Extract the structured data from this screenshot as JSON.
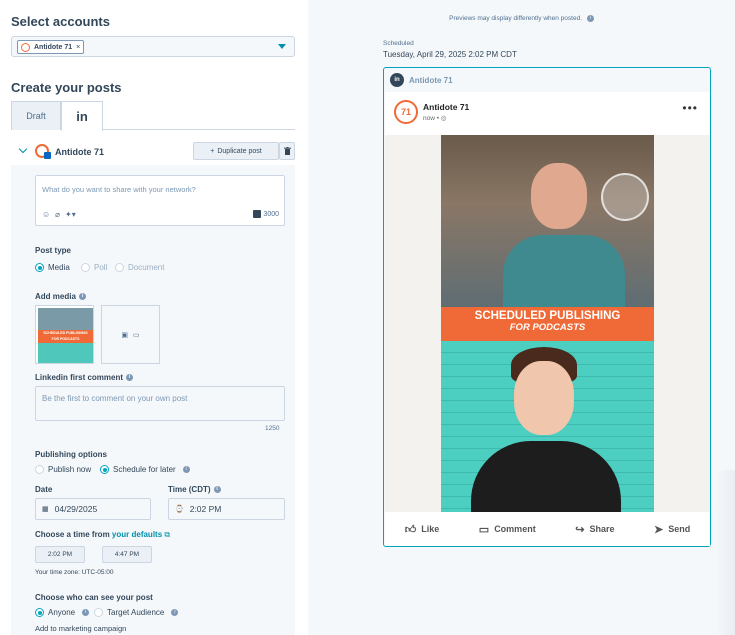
{
  "left": {
    "select_accounts_title": "Select accounts",
    "account_chip": "Antidote 71",
    "create_posts_title": "Create your posts",
    "tabs": [
      {
        "label": "Draft"
      },
      {
        "label": "in"
      }
    ],
    "account_row": {
      "name": "Antidote 71",
      "duplicate_label": "Duplicate post",
      "duplicate_icon": "+",
      "trash_icon": "trash-icon"
    },
    "composer": {
      "placeholder": "What do you want to share with your network?",
      "char_count": "3000"
    },
    "post_type": {
      "label": "Post type",
      "options": [
        {
          "label": "Media",
          "selected": true
        },
        {
          "label": "Poll",
          "selected": false
        },
        {
          "label": "Document",
          "selected": false
        }
      ]
    },
    "add_media": {
      "label": "Add media",
      "thumb_line1": "SCHEDULED PUBLISHING",
      "thumb_line2": "FOR PODCASTS"
    },
    "first_comment": {
      "label": "Linkedin first comment",
      "placeholder": "Be the first to comment on your own post",
      "char_count": "1250"
    },
    "publishing": {
      "label": "Publishing options",
      "options": [
        {
          "label": "Publish now",
          "selected": false
        },
        {
          "label": "Schedule for later",
          "selected": true
        }
      ]
    },
    "date": {
      "label": "Date",
      "value": "04/29/2025"
    },
    "time": {
      "label": "Time (CDT)",
      "value": "2:02 PM"
    },
    "choose_time": {
      "prefix": "Choose a time from",
      "link": "your defaults",
      "options": [
        "2:02 PM",
        "4:47 PM"
      ]
    },
    "timezone": "Your time zone: UTC-05:00",
    "visibility": {
      "label": "Choose who can see your post",
      "options": [
        {
          "label": "Anyone",
          "selected": true
        },
        {
          "label": "Target Audience",
          "selected": false
        }
      ]
    },
    "campaign": "Add to marketing campaign"
  },
  "right": {
    "preview_note": "Previews may display differently when posted.",
    "scheduled_label": "Scheduled",
    "scheduled_date": "Tuesday, April 29, 2025 2:02 PM CDT",
    "card_account": "Antidote 71",
    "post": {
      "avatar_text": "71",
      "name": "Antidote 71",
      "meta": "now •",
      "video_line1": "SCHEDULED PUBLISHING",
      "video_line2": "FOR PODCASTS",
      "actions": [
        "Like",
        "Comment",
        "Share",
        "Send"
      ]
    }
  },
  "colors": {
    "accent": "#00a4bd",
    "brand_orange": "#ef6a36",
    "linkedin": "#0a66c2",
    "text": "#33475b"
  }
}
